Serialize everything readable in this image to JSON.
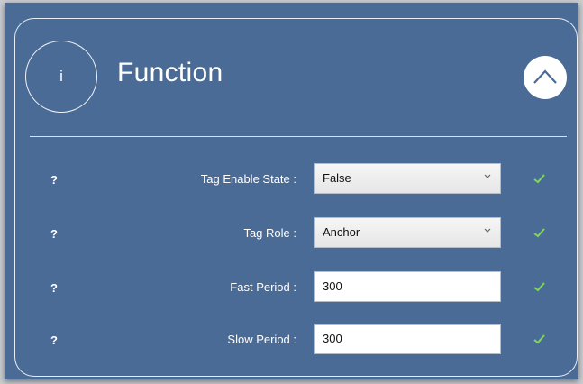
{
  "section": {
    "info_glyph": "i",
    "title": "Function",
    "collapse_icon": "chevron-up-icon"
  },
  "colors": {
    "panel_background": "#4a6b95",
    "text": "#ffffff",
    "check": "#7ed957"
  },
  "rows": [
    {
      "help": "?",
      "label": "Tag Enable State :",
      "type": "select",
      "value": "False"
    },
    {
      "help": "?",
      "label": "Tag Role :",
      "type": "select",
      "value": "Anchor"
    },
    {
      "help": "?",
      "label": "Fast Period :",
      "type": "input",
      "value": "300"
    },
    {
      "help": "?",
      "label": "Slow Period :",
      "type": "input",
      "value": "300"
    }
  ]
}
